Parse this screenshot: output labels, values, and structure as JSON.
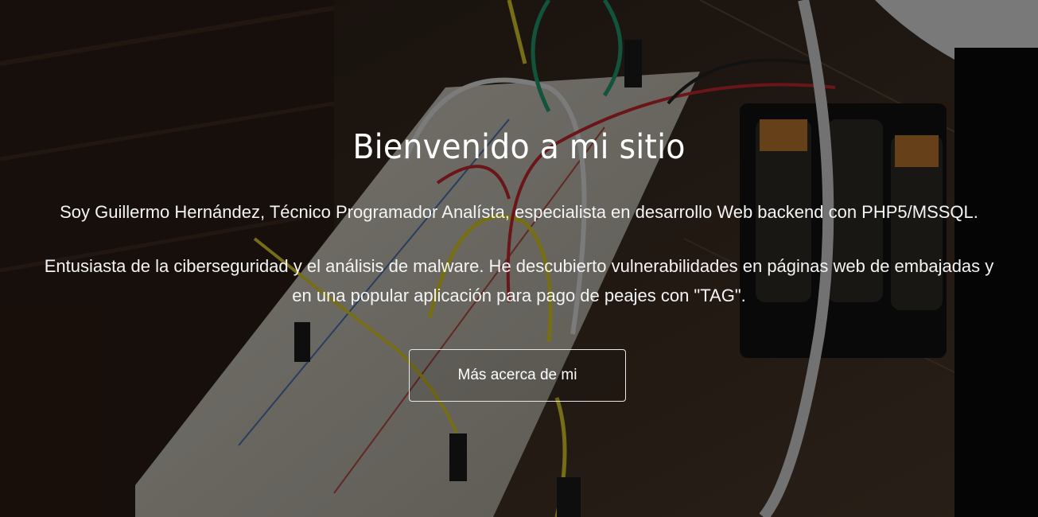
{
  "hero": {
    "title": "Bienvenido a mi sitio",
    "paragraph_1": "Soy Guillermo Hernández, Técnico Programador Analísta, especialista en desarrollo Web backend con PHP5/MSSQL.",
    "paragraph_2_line_1": "Entusiasta de la ciberseguridad y el análisis de malware. He descubierto vulnerabilidades en páginas web de embajadas y",
    "paragraph_2_line_2": "en una popular aplicación para pago de peajes con \"TAG\".",
    "button_label": "Más acerca de mi"
  },
  "colors": {
    "text": "#ffffff",
    "overlay": "rgba(0,0,0,0.45)",
    "button_border": "#e8e8e8"
  }
}
